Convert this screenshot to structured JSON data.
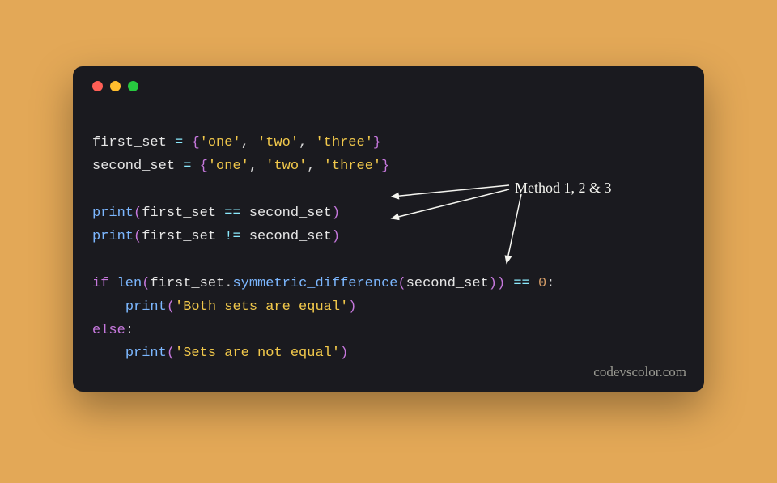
{
  "annotation": {
    "label": "Method 1, 2 & 3"
  },
  "watermark": "codevscolor.com",
  "code": {
    "line1": {
      "var1": "first_set",
      "op": " = ",
      "brace_open": "{",
      "s1": "'one'",
      "c1": ", ",
      "s2": "'two'",
      "c2": ", ",
      "s3": "'three'",
      "brace_close": "}"
    },
    "line2": {
      "var1": "second_set",
      "op": " = ",
      "brace_open": "{",
      "s1": "'one'",
      "c2": ", ",
      "s2": "'two'",
      "c3": ", ",
      "s3": "'three'",
      "brace_close": "}"
    },
    "line4": {
      "fn": "print",
      "po": "(",
      "v1": "first_set",
      "op": " == ",
      "v2": "second_set",
      "pc": ")"
    },
    "line5": {
      "fn": "print",
      "po": "(",
      "v1": "first_set",
      "op": " != ",
      "v2": "second_set",
      "pc": ")"
    },
    "line7": {
      "kw": "if",
      "sp": " ",
      "len": "len",
      "po1": "(",
      "v1": "first_set",
      "dot": ".",
      "method": "symmetric_difference",
      "po2": "(",
      "v2": "second_set",
      "pc2": ")",
      "pc1": ")",
      "op": " == ",
      "num": "0",
      "colon": ":"
    },
    "line8": {
      "indent": "    ",
      "fn": "print",
      "po": "(",
      "s": "'Both sets are equal'",
      "pc": ")"
    },
    "line9": {
      "kw": "else",
      "colon": ":"
    },
    "line10": {
      "indent": "    ",
      "fn": "print",
      "po": "(",
      "s": "'Sets are not equal'",
      "pc": ")"
    }
  }
}
